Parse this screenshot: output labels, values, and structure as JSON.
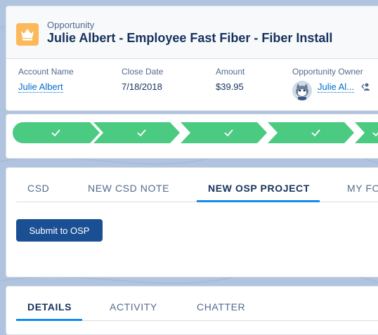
{
  "header": {
    "object_type": "Opportunity",
    "record_title": "Julie Albert - Employee Fast Fiber - Fiber Install",
    "icon": "crown-icon"
  },
  "highlights": {
    "account_name": {
      "label": "Account Name",
      "value": "Julie Albert"
    },
    "close_date": {
      "label": "Close Date",
      "value": "7/18/2018"
    },
    "amount": {
      "label": "Amount",
      "value": "$39.95"
    },
    "owner": {
      "label": "Opportunity Owner",
      "value": "Julie Al...",
      "action_icon": "change-owner-icon"
    }
  },
  "path": {
    "steps_completed": 5,
    "step_icon": "check-icon",
    "color": "#4bca81"
  },
  "tabs_primary": {
    "items": [
      {
        "label": "CSD"
      },
      {
        "label": "NEW CSD NOTE"
      },
      {
        "label": "NEW OSP PROJECT"
      },
      {
        "label": "MY FO"
      }
    ],
    "active_index": 2,
    "submit_button": "Submit to OSP"
  },
  "tabs_secondary": {
    "items": [
      {
        "label": "DETAILS"
      },
      {
        "label": "ACTIVITY"
      },
      {
        "label": "CHATTER"
      }
    ],
    "active_index": 0
  },
  "colors": {
    "brand": "#1589ee",
    "button": "#1b4f94",
    "link": "#006dcc",
    "icon_bg": "#fcb95b"
  }
}
